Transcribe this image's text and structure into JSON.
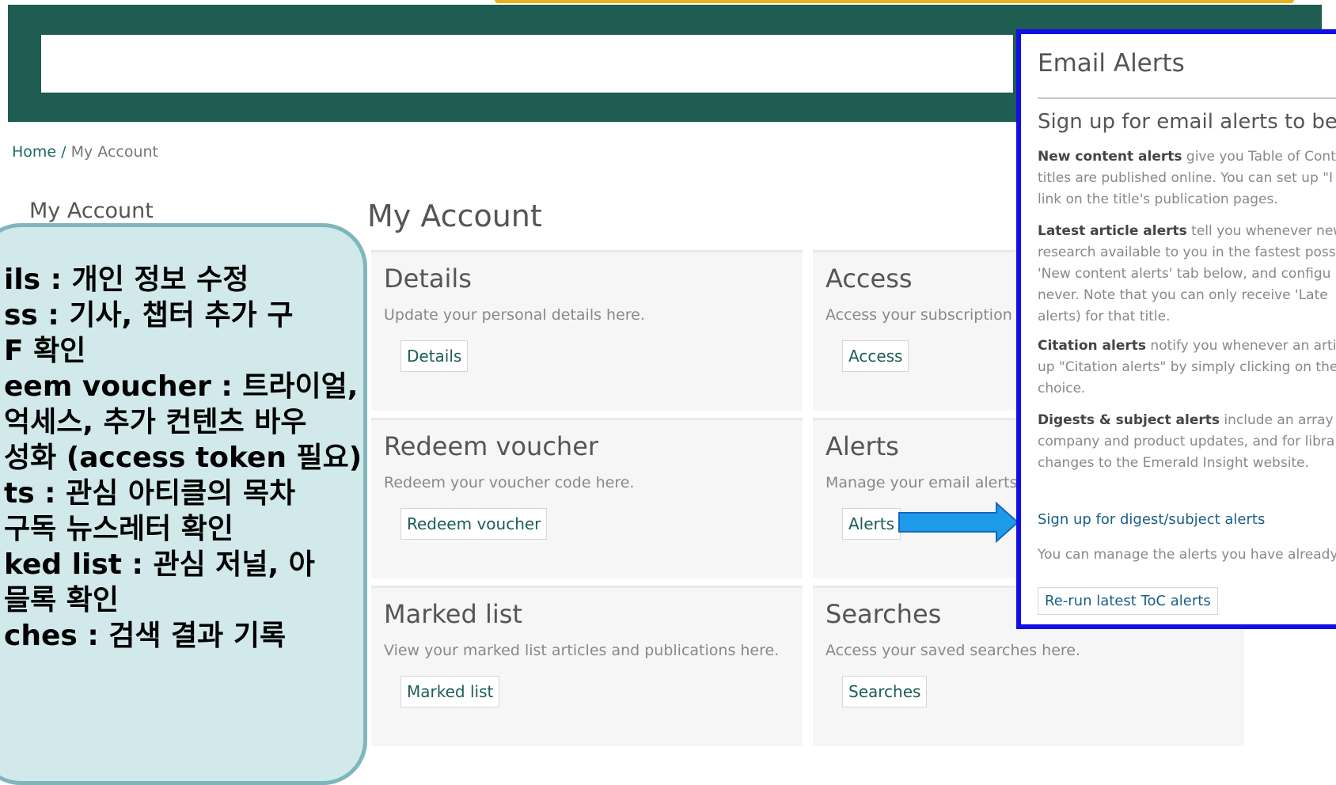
{
  "header": {
    "search_placeholder": ""
  },
  "breadcrumb": {
    "home": "Home",
    "separator": "/",
    "current": "My Account"
  },
  "sidebar": {
    "title": "My Account"
  },
  "main": {
    "title": "My Account",
    "cards": [
      {
        "id": "details",
        "title": "Details",
        "description": "Update your personal details here.",
        "button": "Details"
      },
      {
        "id": "access",
        "title": "Access",
        "description": "Access your subscription",
        "button": "Access"
      },
      {
        "id": "redeem",
        "title": "Redeem voucher",
        "description": "Redeem your voucher code here.",
        "button": "Redeem voucher"
      },
      {
        "id": "alerts",
        "title": "Alerts",
        "description": "Manage your email alerts",
        "button": "Alerts"
      },
      {
        "id": "marked",
        "title": "Marked list",
        "description": "View your marked list articles and publications here.",
        "button": "Marked list"
      },
      {
        "id": "searches",
        "title": "Searches",
        "description": "Access your saved searches here.",
        "button": "Searches"
      }
    ]
  },
  "annotation": {
    "lines": [
      "ils : 개인 정보 수정",
      "ss : 기사, 챕터 추가 구",
      "F 확인",
      "eem voucher : 트라이얼,",
      "억세스, 추가 컨텐츠 바우",
      "성화 (access token 필요)",
      "ts : 관심 아티클의 목차",
      "구독 뉴스레터 확인",
      "ked list : 관심 저널, 아",
      "믈록 확인",
      "ches : 검색 결과 기록"
    ]
  },
  "email_alerts": {
    "title": "Email Alerts",
    "subtitle": "Sign up for email alerts to be nc",
    "sections": [
      {
        "bold": "New content alerts",
        "lines": [
          " give you Table of Conte",
          "titles are published online. You can set up \"I",
          "link on the title's publication pages."
        ]
      },
      {
        "bold": "Latest article alerts",
        "lines": [
          " tell you whenever new E",
          "research available to you in the fastest poss",
          "'New content alerts' tab below, and configu",
          "never. Note that you can only receive 'Late",
          "alerts) for that title."
        ]
      },
      {
        "bold": "Citation alerts",
        "lines": [
          " notify you whenever an artic",
          "up \"Citation alerts\" by simply clicking on the",
          "choice."
        ]
      },
      {
        "bold": "Digests & subject alerts",
        "lines": [
          " include an array of",
          "company and product updates, and for libra",
          "changes to the Emerald Insight website."
        ]
      }
    ],
    "signup_link": "Sign up for digest/subject alerts",
    "manage_text": "You can manage the alerts you have already",
    "rerun_button": "Re-run latest ToC alerts"
  },
  "colors": {
    "banner": "#1f5c52",
    "accent_border": "#1010e6",
    "arrow": "#1e9be8",
    "annotation_bg": "#d1e9ea"
  }
}
